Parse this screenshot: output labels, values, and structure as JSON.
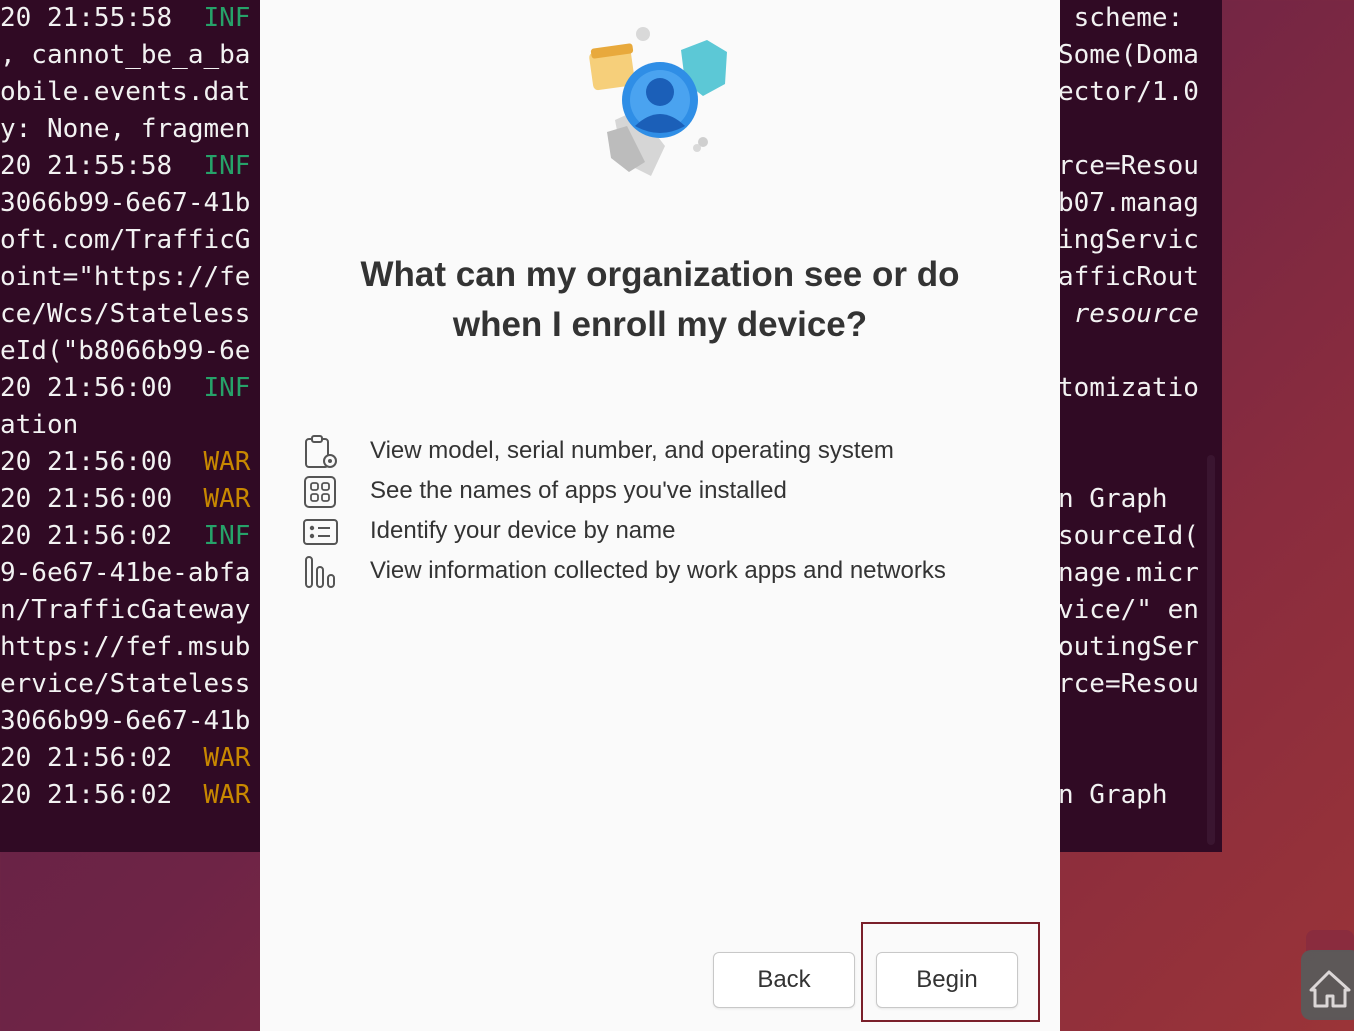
{
  "terminal": {
    "left_lines": [
      {
        "text": "20 21:55:58  ",
        "level": "INF"
      },
      {
        "text": ", cannot_be_a_ba",
        "level": ""
      },
      {
        "text": "obile.events.dat",
        "level": ""
      },
      {
        "text": "y: None, fragmen",
        "level": ""
      },
      {
        "text": "20 21:55:58  ",
        "level": "INF"
      },
      {
        "text": "3066b99-6e67-41b",
        "level": ""
      },
      {
        "text": "oft.com/TrafficG",
        "level": ""
      },
      {
        "text": "oint=\"https://fe",
        "level": ""
      },
      {
        "text": "ce/Wcs/Stateless",
        "level": ""
      },
      {
        "text": "eId(\"b8066b99-6e",
        "level": ""
      },
      {
        "text": "20 21:56:00  ",
        "level": "INF"
      },
      {
        "text": "ation",
        "level": ""
      },
      {
        "text": "20 21:56:00  ",
        "level": "WAR"
      },
      {
        "text": "20 21:56:00  ",
        "level": "WAR"
      },
      {
        "text": "20 21:56:02  ",
        "level": "INF"
      },
      {
        "text": "9-6e67-41be-abfa",
        "level": ""
      },
      {
        "text": "n/TrafficGateway",
        "level": ""
      },
      {
        "text": "https://fef.msub",
        "level": ""
      },
      {
        "text": "ervice/Stateless",
        "level": ""
      },
      {
        "text": "3066b99-6e67-41b",
        "level": ""
      },
      {
        "text": "20 21:56:02  ",
        "level": "WAR"
      },
      {
        "text": "20 21:56:02  ",
        "level": "WAR"
      }
    ],
    "right_lines": [
      {
        "row": 0,
        "text": " scheme:",
        "italic": false
      },
      {
        "row": 1,
        "text": "Some(Doma",
        "italic": false
      },
      {
        "row": 2,
        "text": "ector/1.0",
        "italic": false
      },
      {
        "row": 4,
        "text": "rce=Resou",
        "italic": false
      },
      {
        "row": 5,
        "text": "b07.manag",
        "italic": false
      },
      {
        "row": 6,
        "text": "ingServic",
        "italic": false
      },
      {
        "row": 7,
        "text": "afficRout",
        "italic": false
      },
      {
        "row": 8,
        "text": " resource",
        "italic": true
      },
      {
        "row": 10,
        "text": "tomizatio",
        "italic": false
      },
      {
        "row": 13,
        "text": "n Graph",
        "italic": false
      },
      {
        "row": 14,
        "text": "sourceId(",
        "italic": false
      },
      {
        "row": 15,
        "text": "nage.micr",
        "italic": false
      },
      {
        "row": 16,
        "text": "vice/\" en",
        "italic": false
      },
      {
        "row": 17,
        "text": "outingSer",
        "italic": false
      },
      {
        "row": 18,
        "text": "rce=Resou",
        "italic": false
      },
      {
        "row": 21,
        "text": "n Graph",
        "italic": false
      }
    ]
  },
  "dialog": {
    "hero_icon": "device-enrollment-illustration",
    "heading_line1": "What can my organization see or do",
    "heading_line2": "when I enroll my device?",
    "permissions": [
      {
        "icon": "clipboard-gear-icon",
        "text": "View model, serial number, and operating system"
      },
      {
        "icon": "apps-grid-icon",
        "text": "See the names of apps you've installed"
      },
      {
        "icon": "id-card-icon",
        "text": "Identify your device by name"
      },
      {
        "icon": "bar-chart-icon",
        "text": "View information collected by work apps and networks"
      }
    ],
    "back_label": "Back",
    "begin_label": "Begin"
  },
  "colors": {
    "terminal_bg": "#300a24",
    "dialog_bg": "#fafafa",
    "highlight": "#7a1f2a",
    "info": "#26a269",
    "warn": "#c88800"
  }
}
